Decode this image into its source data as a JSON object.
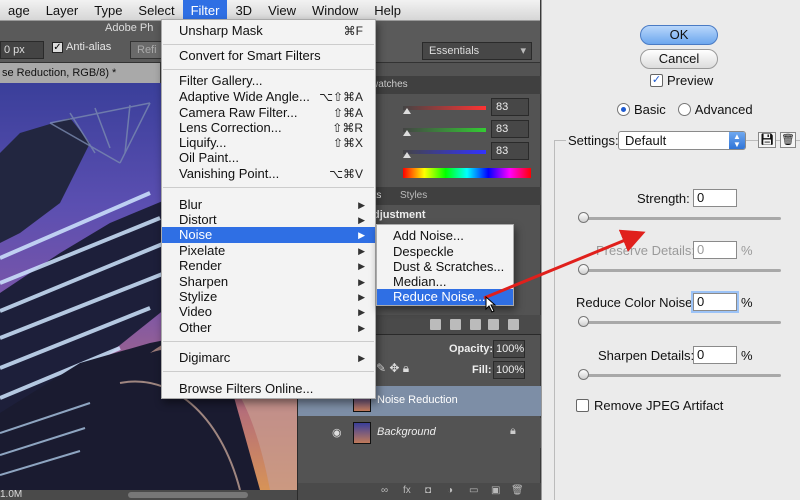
{
  "menubar": {
    "items": [
      "age",
      "Layer",
      "Type",
      "Select",
      "Filter",
      "3D",
      "View",
      "Window",
      "Help"
    ],
    "active_index": 4
  },
  "options_bar": {
    "app_title": "Adobe Ph",
    "feather_value": "0 px",
    "anti_alias_label": "Anti-alias",
    "refine_label": "Refi",
    "workspace": "Essentials"
  },
  "document": {
    "tab_title": "se Reduction, RGB/8) *",
    "status": "1.0M"
  },
  "panels": {
    "swatches_tab": "watches",
    "color_values": [
      "83",
      "83",
      "83"
    ],
    "tabs": [
      "nts",
      "Styles"
    ],
    "adjustment_label": "djustment",
    "opacity_label": "Opacity:",
    "opacity_value": "100%",
    "fill_label": "Fill:",
    "fill_value": "100%",
    "layers": [
      {
        "name": "Noise Reduction",
        "selected": true
      },
      {
        "name": "Background",
        "selected": false,
        "locked": true
      }
    ],
    "bottom_icons": [
      "link-icon",
      "fx-icon",
      "mask-icon",
      "adjustment-icon",
      "folder-icon",
      "new-layer-icon",
      "trash-icon"
    ]
  },
  "filter_menu": {
    "items": [
      {
        "label": "Unsharp Mask",
        "shortcut": "⌘F"
      },
      {
        "label": "Convert for Smart Filters"
      },
      {
        "label": "Filter Gallery..."
      },
      {
        "label": "Adaptive Wide Angle...",
        "shortcut": "⌥⇧⌘A"
      },
      {
        "label": "Camera Raw Filter...",
        "shortcut": "⇧⌘A"
      },
      {
        "label": "Lens Correction...",
        "shortcut": "⇧⌘R"
      },
      {
        "label": "Liquify...",
        "shortcut": "⇧⌘X"
      },
      {
        "label": "Oil Paint..."
      },
      {
        "label": "Vanishing Point...",
        "shortcut": "⌥⌘V"
      },
      {
        "label": "Blur"
      },
      {
        "label": "Distort"
      },
      {
        "label": "Noise"
      },
      {
        "label": "Pixelate"
      },
      {
        "label": "Render"
      },
      {
        "label": "Sharpen"
      },
      {
        "label": "Stylize"
      },
      {
        "label": "Video"
      },
      {
        "label": "Other"
      },
      {
        "label": "Digimarc"
      },
      {
        "label": "Browse Filters Online..."
      }
    ],
    "highlighted": "Noise"
  },
  "noise_submenu": {
    "items": [
      "Add Noise...",
      "Despeckle",
      "Dust & Scratches...",
      "Median...",
      "Reduce Noise..."
    ],
    "highlighted": "Reduce Noise..."
  },
  "dialog": {
    "ok_label": "OK",
    "cancel_label": "Cancel",
    "preview_label": "Preview",
    "preview_checked": true,
    "mode_basic": "Basic",
    "mode_advanced": "Advanced",
    "mode_selected": "Basic",
    "settings_label": "Settings:",
    "settings_value": "Default",
    "strength_label": "Strength:",
    "strength_value": "0",
    "preserve_label": "Preserve Details:",
    "preserve_value": "0",
    "color_noise_label": "Reduce Color Noise:",
    "color_noise_value": "0",
    "sharpen_label": "Sharpen Details:",
    "sharpen_value": "0",
    "percent": "%",
    "jpeg_label": "Remove JPEG Artifact",
    "jpeg_checked": false
  },
  "colors": {
    "menu_highlight": "#2f6fe4",
    "annotation_arrow": "#e0201c",
    "panel_bg": "#535353",
    "dialog_bg": "#ebebeb"
  }
}
